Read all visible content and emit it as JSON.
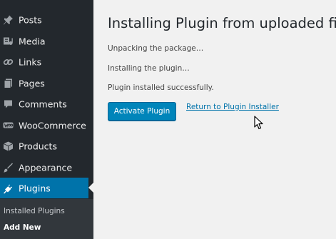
{
  "sidebar": {
    "items": [
      {
        "label": "Posts",
        "icon": "pushpin-icon"
      },
      {
        "label": "Media",
        "icon": "media-icon"
      },
      {
        "label": "Links",
        "icon": "link-icon"
      },
      {
        "label": "Pages",
        "icon": "pages-icon"
      },
      {
        "label": "Comments",
        "icon": "comment-icon"
      },
      {
        "label": "WooCommerce",
        "icon": "woocommerce-icon"
      },
      {
        "label": "Products",
        "icon": "products-icon"
      },
      {
        "label": "Appearance",
        "icon": "appearance-icon"
      },
      {
        "label": "Plugins",
        "icon": "plugins-icon"
      }
    ],
    "active_item": "Plugins",
    "submenu": [
      {
        "label": "Installed Plugins"
      },
      {
        "label": "Add New"
      }
    ],
    "colors": {
      "background": "#23282d",
      "active": "#0073aa",
      "submenu_background": "#32373c"
    }
  },
  "main": {
    "title": "Installing Plugin from uploaded file:",
    "messages": [
      "Unpacking the package…",
      "Installing the plugin…",
      "Plugin installed successfully."
    ],
    "activate_button": "Activate Plugin",
    "return_link": "Return to Plugin Installer",
    "colors": {
      "button": "#0085ba",
      "link": "#0073aa"
    }
  }
}
